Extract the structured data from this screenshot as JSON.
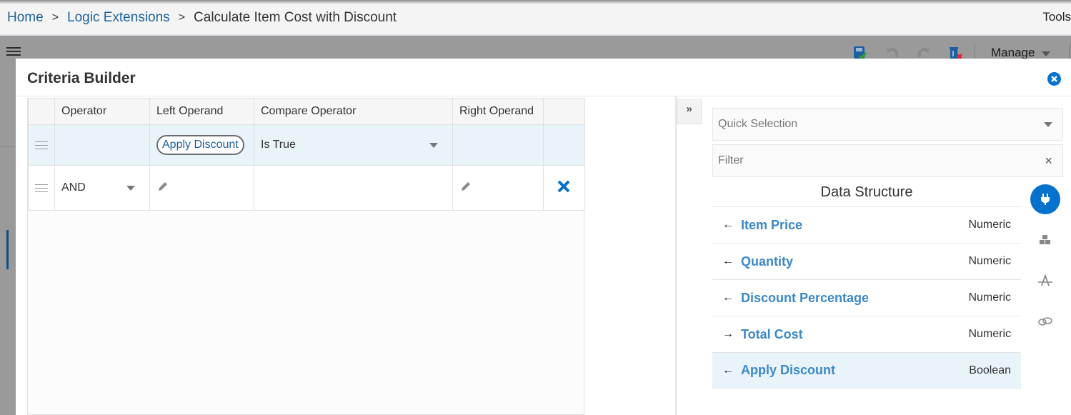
{
  "breadcrumb": {
    "items": [
      {
        "label": "Home",
        "link": true
      },
      {
        "label": "Logic Extensions",
        "link": true
      },
      {
        "label": "Calculate Item Cost with Discount",
        "link": false
      }
    ],
    "separator": ">"
  },
  "header": {
    "tools_label": "Tools",
    "manage_label": "Manage",
    "toolbar_icons": [
      "save-icon",
      "undo-icon",
      "redo-icon",
      "delete-icon"
    ]
  },
  "dialog": {
    "title": "Criteria Builder",
    "close_icon": "close-circle-icon"
  },
  "criteria": {
    "columns": [
      "",
      "Operator",
      "Left Operand",
      "Compare Operator",
      "Right Operand",
      ""
    ],
    "rows": [
      {
        "operator": "",
        "left_operand": "Apply Discount",
        "compare_operator": "Is True",
        "right_operand": "",
        "selected": true
      },
      {
        "operator": "AND",
        "left_operand": "",
        "compare_operator": "",
        "right_operand": "",
        "selected": false
      }
    ]
  },
  "panel": {
    "collapse_icon": "double-chevron-right-icon",
    "quick_selection_placeholder": "Quick Selection",
    "filter_placeholder": "Filter",
    "data_structure_title": "Data Structure",
    "items": [
      {
        "name": "Item Price",
        "type": "Numeric",
        "direction": "input",
        "arrow": "←"
      },
      {
        "name": "Quantity",
        "type": "Numeric",
        "direction": "input",
        "arrow": "←"
      },
      {
        "name": "Discount Percentage",
        "type": "Numeric",
        "direction": "input",
        "arrow": "←"
      },
      {
        "name": "Total Cost",
        "type": "Numeric",
        "direction": "output",
        "arrow": "→"
      },
      {
        "name": "Apply Discount",
        "type": "Boolean",
        "direction": "input",
        "arrow": "←",
        "selected": true
      }
    ],
    "rail_icons": [
      "plug-icon",
      "cubes-icon",
      "function-icon",
      "link-icon"
    ]
  },
  "colors": {
    "accent": "#0572ce",
    "link": "#1c62a0",
    "selected_row": "#e8f3fa",
    "data_item": "#3b88c8"
  }
}
